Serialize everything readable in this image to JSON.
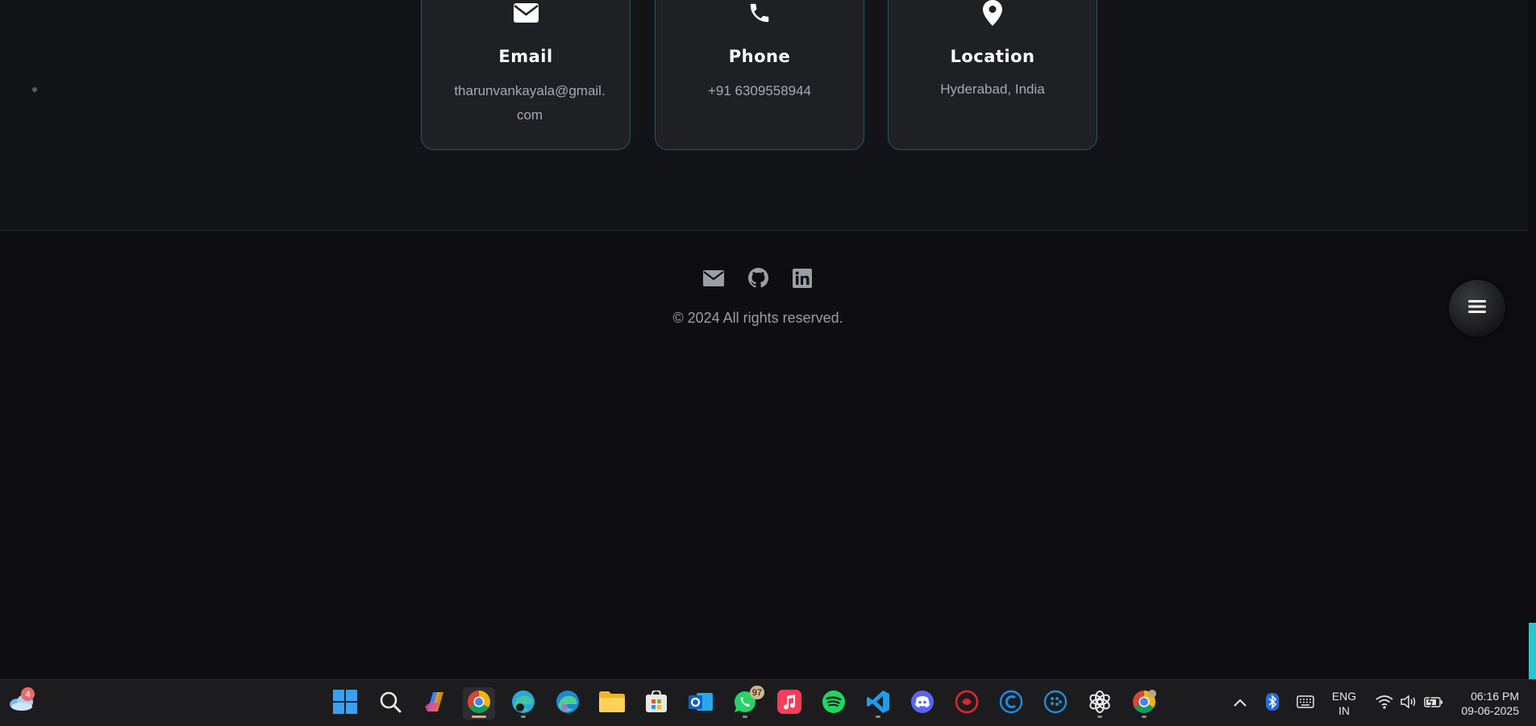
{
  "contact_cards": [
    {
      "icon": "envelope-icon",
      "title": "Email",
      "value": "tharunvankayala@gmail.com"
    },
    {
      "icon": "phone-icon",
      "title": "Phone",
      "value": "+91 6309558944"
    },
    {
      "icon": "map-pin-icon",
      "title": "Location",
      "value": "Hyderabad, India"
    }
  ],
  "footer": {
    "social": [
      "envelope-icon",
      "github-icon",
      "linkedin-icon"
    ],
    "copyright": "© 2024 All rights reserved."
  },
  "colors": {
    "accent": "#1ecbd2",
    "card_border": "#1f5a59",
    "background": "#0e0e10"
  },
  "taskbar": {
    "weather_badge": "4",
    "whatsapp_badge": "97",
    "language": "ENG",
    "region": "IN",
    "time": "06:16 PM",
    "date": "09-06-2025"
  }
}
